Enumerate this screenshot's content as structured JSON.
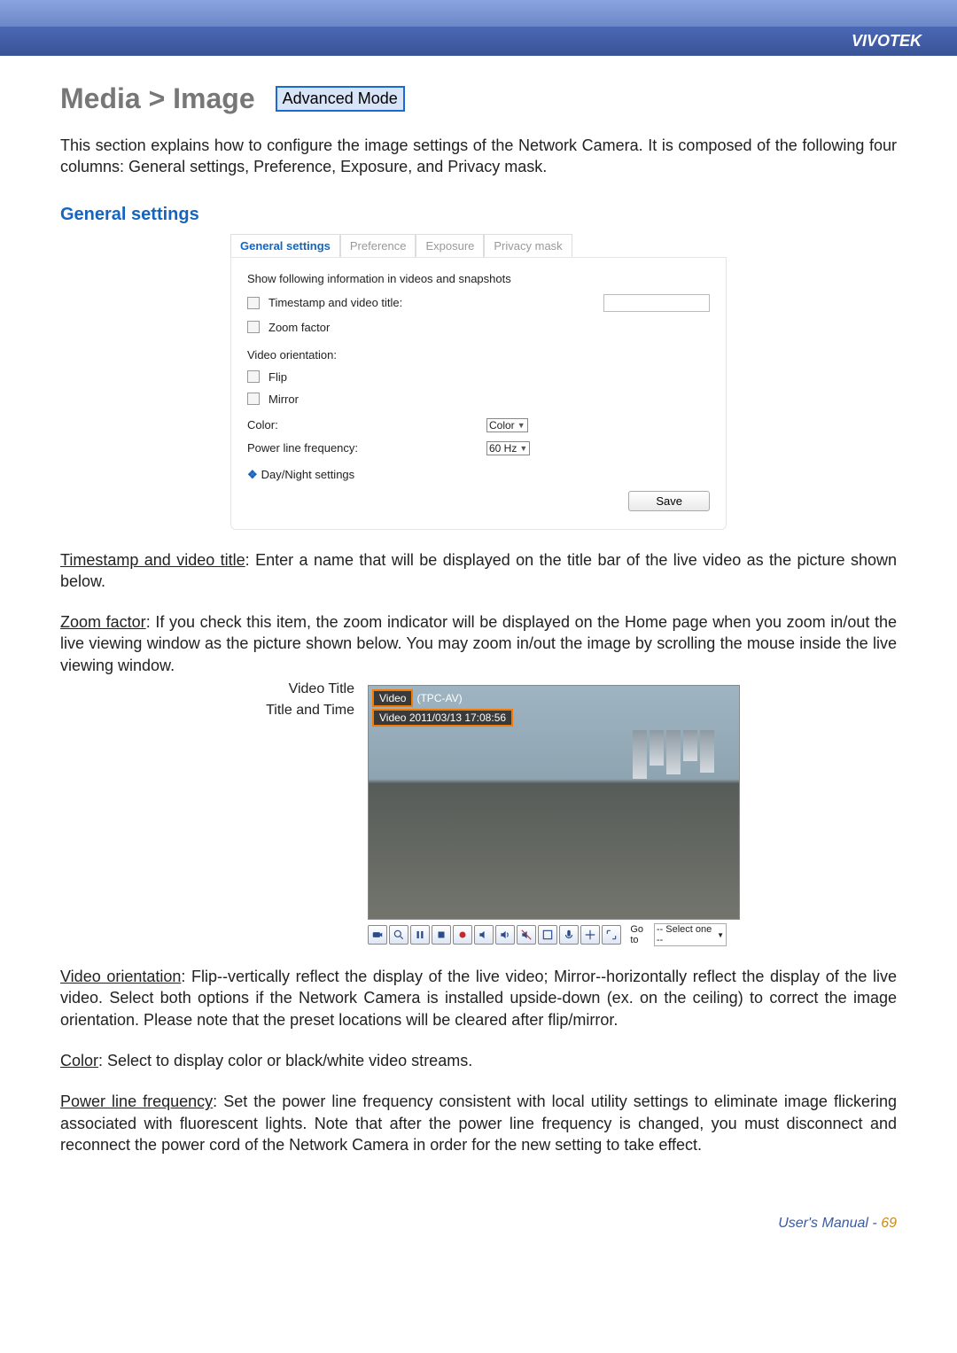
{
  "brand": "VIVOTEK",
  "heading": "Media > Image",
  "badge": "Advanced Mode",
  "intro": "This section explains how to configure the image settings of the Network Camera. It is composed of the following four columns: General settings, Preference, Exposure, and Privacy mask.",
  "subheading": "General settings",
  "tabs": [
    "General settings",
    "Preference",
    "Exposure",
    "Privacy mask"
  ],
  "panel": {
    "line1": "Show following information in videos and snapshots",
    "timestamp": "Timestamp and video title:",
    "zoom": "Zoom factor",
    "orientation": "Video orientation:",
    "flip": "Flip",
    "mirror": "Mirror",
    "colorLabel": "Color:",
    "colorValue": "Color",
    "freqLabel": "Power line frequency:",
    "freqValue": "60 Hz",
    "dayNight": "Day/Night settings",
    "save": "Save"
  },
  "desc": {
    "tsTitle": "Timestamp and video title",
    "tsBody": ": Enter a name that will be displayed on the title bar of the live video as the picture shown below.",
    "zfTitle": "Zoom factor",
    "zfBody": ": If you check this item, the zoom indicator will be displayed on the Home page when you zoom in/out the live viewing window as the picture shown below. You may zoom in/out the image by scrolling the mouse inside the live viewing window.",
    "vtLabel": "Video Title",
    "ttLabel": "Title and Time",
    "videoWord": "Video",
    "videoSuffix": "(TPC-AV)",
    "videoTime": "2011/03/13 17:08:56",
    "goTo": "Go to",
    "goToSel": "-- Select one --",
    "orTitle": "Video orientation",
    "orBody": ": Flip--vertically reflect the display of the live video; Mirror--horizontally reflect the display of the live video. Select both options if the Network Camera is installed upside-down (ex. on the ceiling) to correct the image orientation. Please note that the preset locations will be cleared after flip/mirror.",
    "clTitle": "Color",
    "clBody": ": Select to display color or black/white video streams.",
    "plTitle": "Power line frequency",
    "plBody": ": Set the power line frequency consistent with local utility settings to eliminate image flickering associated with fluorescent lights. Note that after the power line frequency is changed, you must disconnect and reconnect the power cord of the Network Camera in order for the new setting to take effect."
  },
  "footer": {
    "label": "User's Manual - ",
    "page": "69"
  },
  "icons": [
    "camera-icon",
    "zoom-icon",
    "pause-icon",
    "stop-icon",
    "record-icon",
    "volume-up-icon",
    "speaker-icon",
    "mic-off-icon",
    "fullscreen-icon",
    "mic-icon",
    "ptz-icon",
    "expand-icon"
  ]
}
